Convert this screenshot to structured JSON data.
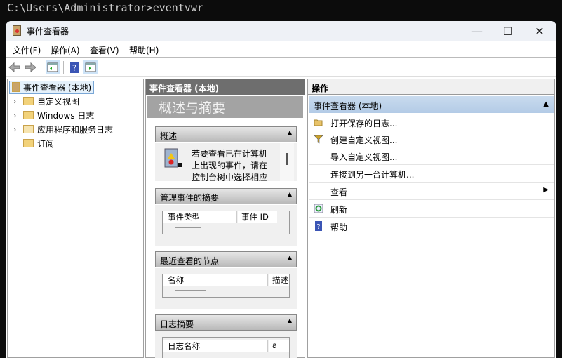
{
  "terminal": {
    "command_line": "C:\\Users\\Administrator>eventvwr"
  },
  "window": {
    "title": "事件查看器",
    "minimize": "—",
    "maximize": "☐",
    "close": "✕"
  },
  "menu": [
    "文件(F)",
    "操作(A)",
    "查看(V)",
    "帮助(H)"
  ],
  "tree": {
    "root": "事件查看器 (本地)",
    "items": [
      "自定义视图",
      "Windows 日志",
      "应用程序和服务日志",
      "订阅"
    ]
  },
  "middle": {
    "header": "事件查看器 (本地)",
    "subtitle": "概述与摘要",
    "sections": [
      {
        "title": "概述",
        "text": [
          "若要查看已在计算机",
          "上出现的事件，请在",
          "控制台树中选择相应"
        ]
      },
      {
        "title": "管理事件的摘要",
        "columns": [
          "事件类型",
          "事件 ID"
        ]
      },
      {
        "title": "最近查看的节点",
        "columns": [
          "名称",
          "描述"
        ]
      },
      {
        "title": "日志摘要",
        "columns": [
          "日志名称",
          "a"
        ]
      }
    ]
  },
  "actions": {
    "header": "操作",
    "group": "事件查看器 (本地)",
    "items": [
      "打开保存的日志...",
      "创建自定义视图...",
      "导入自定义视图...",
      "连接到另一台计算机...",
      "查看",
      "刷新",
      "帮助"
    ]
  }
}
